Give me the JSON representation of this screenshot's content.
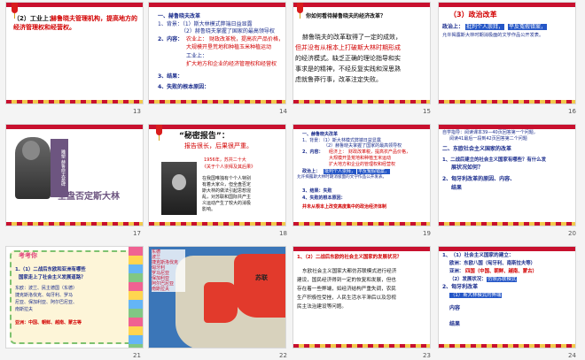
{
  "slides": [
    {
      "number": "13",
      "lines": [
        "（2）工业上：",
        "赫鲁晓夫管理机构，提高地方的",
        "经济管理权和经营权。"
      ]
    },
    {
      "number": "14",
      "lines": [
        "一、赫鲁晓夫改革",
        "1、背景：（1）斯大林模式弊端日益显露",
        "（2）赫鲁晓夫掌握了国家的最高领导权",
        "2、内容：",
        "农业上：",
        "财政改革税，提高农产品价格，",
        "大规模开垦荒地和种植玉米种植运动",
        "工业上：",
        "扩大地方和企业的经济管理权和经营权",
        "3、结果：",
        "4、失败的根本原因："
      ]
    },
    {
      "number": "15",
      "question": "你如何看待赫鲁晓夫的经济改革？",
      "lines": [
        "赫鲁晓夫的改革取得了一定的成效，",
        "但并没有从根本上打破斯大林时期形成",
        "的经济模式。缺乏正确的理论指导和实",
        "事求是的精神，不经反复实践和深思熟",
        "虑就鲁莽行事，改革注定失败。"
      ]
    },
    {
      "number": "16",
      "heading": "（3）政治改革",
      "lines": [
        "政治上：",
        "批判个人崇拜，",
        "平反冤假错案，",
        "允许揭露斯大林时期消极面的文学作品公开发表。"
      ]
    },
    {
      "number": "17",
      "side_label": "雕塑 赫鲁晓夫墓碑",
      "caption": "全盘否定斯大林"
    },
    {
      "number": "18",
      "title": "“秘密报告”：",
      "subtitle": "报告很长，后果很严重。",
      "photo_caption": "1956年，苏共二十大",
      "photo_caption2": "《关于个人崇拜及其后果》",
      "body": [
        "在我国唯独有个个人特别",
        "有着大家众，但全盘否定",
        "斯大林的做法引起思想混",
        "乱，对苏联和国际共产主",
        "义运动产生了较大的消极",
        "影响。"
      ]
    },
    {
      "number": "19",
      "lines": [
        "一、赫鲁晓夫改革",
        "1、背景：（1）斯大林模式弊端日益显露",
        "（2）赫鲁晓夫掌握了国家的最高领导权",
        "2、内容：",
        "经济上：",
        "财政改革税，提高农产品价格，",
        "大规模开垦荒地和种植玉米运动",
        "扩大地方和企业的管理权和经营权",
        "政治上：",
        "批判个人崇拜，",
        "平反冤假错案，",
        "允许揭露斯大林时期消极面的文学作品公开发表。",
        "3、结果：失败",
        "4、失败的根本原因：",
        "并未从根本上改变高度集中的政治经济体制"
      ]
    },
    {
      "number": "20",
      "lines": [
        "自学指导：阅读课本39—40页回答第一个问题，",
        "阅读41最后一段到42页回答第二个问题",
        "二、东欧社会主义国家的改革",
        "1、二战后建立的社会主义国家有哪些？有什么发",
        "展状况如何？",
        "2、匈牙利改革的原因、内容、",
        "结果"
      ]
    },
    {
      "number": "21",
      "title": "考考你",
      "lines": [
        "1.（1）二战后东欧和亚洲有哪些",
        "国家走上了社会主义发展道路？",
        "东欧：波兰、民主德国（东德）",
        "捷克斯洛伐克、匈牙利、罗马",
        "尼亚、保加利亚、阿尔巴尼亚、",
        "南斯拉夫",
        "亚洲：中国、朝鲜、越南、蒙古等"
      ]
    },
    {
      "number": "22",
      "map_list": [
        "东德",
        "波兰",
        "捷克斯洛伐克",
        "匈牙利",
        "罗马尼亚",
        "保加利亚",
        "阿尔巴尼亚",
        "南斯拉夫"
      ],
      "map_label": "苏联"
    },
    {
      "number": "23",
      "heading": "1、（2）二战后东欧的社会主义国家的发展状况？",
      "lines": [
        "东欧社会主义国家大都仿苏联模式进行经济",
        "建设，国民经济得到一定的恢复和发展，但也",
        "存在着一些弊端，如经济结构严重失调，农民",
        "生产积极性受挫，人民生活水平滞后以及忽视",
        "民主法治建设等问题。"
      ]
    },
    {
      "number": "24",
      "lines": [
        "1、（1）社会主义国家的建立：",
        "欧洲：东欧八国（匈牙利、南斯拉夫等）",
        "亚洲：",
        "四国（中国、朝鲜、越南、蒙古）",
        "（2）发展状况：",
        "仿照苏联模式",
        "2、匈牙利改革",
        "（1）斯大林模式的弊端",
        "内容",
        "结果"
      ]
    }
  ],
  "colors": {
    "red": "#d20000",
    "blue": "#1a2c8c",
    "highlight": "#2456c7"
  }
}
